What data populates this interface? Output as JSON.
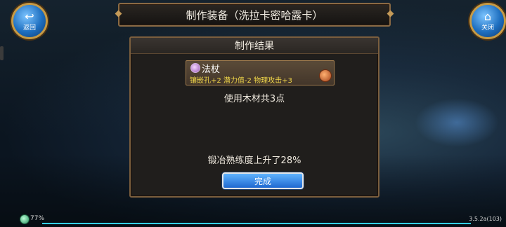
{
  "header": {
    "title": "制作装备（洗拉卡密哈露卡）"
  },
  "buttons": {
    "back": {
      "label": "返回",
      "icon": "back-arrow-icon"
    },
    "close": {
      "label": "关闭",
      "icon": "house-icon"
    }
  },
  "dialog": {
    "title": "制作结果",
    "item": {
      "name": "法杖",
      "stats": "镶嵌孔+2  潜力值-2  物理攻击+3",
      "icon": "staff-icon"
    },
    "material_text": "使用木材共3点",
    "proficiency_text": "锻冶熟练度上升了28%",
    "done_label": "完成"
  },
  "status": {
    "battery": "77%",
    "version": "3.5.2a(103)"
  },
  "colors": {
    "frame": "#8a6a44",
    "stat_text": "#f3d94a",
    "button_blue": "#1f68d0"
  }
}
